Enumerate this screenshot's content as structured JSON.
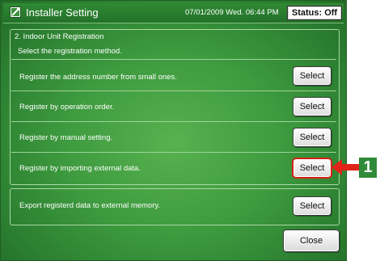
{
  "header": {
    "title": "Installer Setting",
    "datetime": "07/01/2009 Wed. 06:44 PM",
    "status": "Status: Off"
  },
  "section": {
    "title": "2. Indoor Unit Registration",
    "subtitle": "Select the registration method."
  },
  "options": [
    {
      "label": "Register the address number from small ones.",
      "button": "Select"
    },
    {
      "label": "Register by operation order.",
      "button": "Select"
    },
    {
      "label": "Register by manual setting.",
      "button": "Select"
    },
    {
      "label": "Register by importing external data.",
      "button": "Select"
    }
  ],
  "export": {
    "label": "Export registerd data to external memory.",
    "button": "Select"
  },
  "close_label": "Close",
  "callout": {
    "number": "1",
    "color": "#2f8a39",
    "arrow_color": "#e02418"
  },
  "colors": {
    "background": "#3d9a3e",
    "highlight": "#e02418"
  }
}
